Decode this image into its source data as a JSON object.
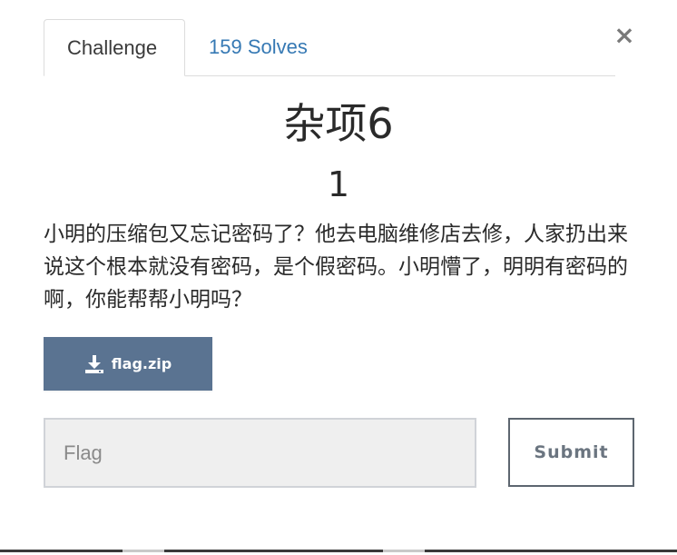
{
  "tabs": [
    {
      "label": "Challenge",
      "active": true
    },
    {
      "label": "159 Solves",
      "active": false
    }
  ],
  "close_label": "×",
  "challenge": {
    "name": "杂项6",
    "value": "1",
    "description": "小明的压缩包又忘记密码了？他去电脑维修店去修，人家扔出来说这个根本就没有密码，是个假密码。小明懵了，明明有密码的啊，你能帮帮小明吗？"
  },
  "file": {
    "name": "flag.zip",
    "icon": "download-icon"
  },
  "submission": {
    "placeholder": "Flag",
    "value": "",
    "submit_label": "Submit"
  },
  "colors": {
    "file_button": "#5a7391",
    "tab_link": "#3679b4",
    "submit_border": "#5d6670"
  }
}
